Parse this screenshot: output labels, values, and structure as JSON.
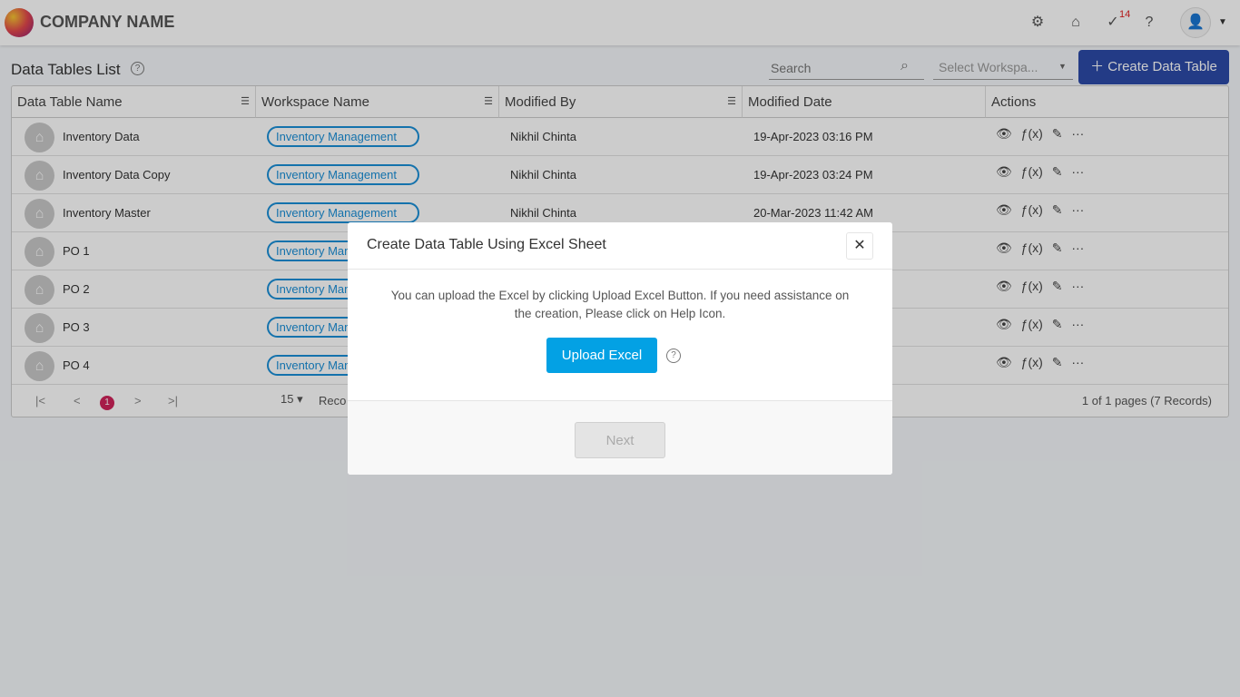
{
  "header": {
    "company": "COMPANY NAME",
    "task_badge": "14",
    "icons": [
      "settings-user-icon",
      "store-icon",
      "task-check-icon",
      "help-icon",
      "user-icon"
    ]
  },
  "page": {
    "title": "Data Tables List",
    "search_placeholder": "Search",
    "workspace_placeholder": "Select Workspa...",
    "create_label": "Create Data Table"
  },
  "table": {
    "columns": [
      "Data Table Name",
      "Workspace Name",
      "Modified By",
      "Modified Date",
      "Actions"
    ],
    "rows": [
      {
        "name": "Inventory Data",
        "workspace": "Inventory Management",
        "by": "Nikhil Chinta",
        "date": "19-Apr-2023 03:16 PM"
      },
      {
        "name": "Inventory Data Copy",
        "workspace": "Inventory Management",
        "by": "Nikhil Chinta",
        "date": "19-Apr-2023 03:24 PM"
      },
      {
        "name": "Inventory Master",
        "workspace": "Inventory Management",
        "by": "Nikhil Chinta",
        "date": "20-Mar-2023 11:42 AM"
      },
      {
        "name": "PO 1",
        "workspace": "Inventory Management",
        "by": "",
        "date": ""
      },
      {
        "name": "PO 2",
        "workspace": "Inventory Management",
        "by": "",
        "date": ""
      },
      {
        "name": "PO 3",
        "workspace": "Inventory Management",
        "by": "",
        "date": ""
      },
      {
        "name": "PO 4",
        "workspace": "Inventory Management",
        "by": "",
        "date": ""
      }
    ],
    "action_icons": [
      "view-icon",
      "formula-icon",
      "edit-icon",
      "more-icon"
    ]
  },
  "pager": {
    "current": "1",
    "page_size": "15",
    "records_label": "Reco",
    "summary": "1 of 1 pages (7 Records)"
  },
  "modal": {
    "title": "Create Data Table Using Excel Sheet",
    "text": "You can upload the Excel by clicking Upload Excel Button. If you need assistance on the creation, Please click on Help Icon.",
    "upload_label": "Upload Excel",
    "next_label": "Next"
  },
  "colors": {
    "primary": "#2c4aa8",
    "upload": "#03a1e4",
    "tag": "#1a8fd8",
    "page_badge": "#d0245a"
  }
}
